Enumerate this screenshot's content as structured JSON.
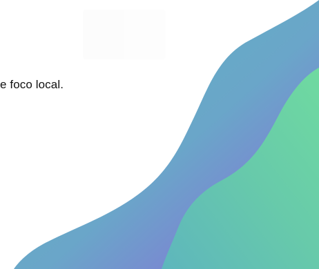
{
  "slide": {
    "text_fragment": "e foco local."
  },
  "decoration": {
    "shape": "wave-ribbon",
    "colors": {
      "teal": "#5eb3bf",
      "purple": "#7b86d2",
      "green": "#6fdaa0",
      "background": "#ffffff",
      "text": "#111111"
    }
  }
}
